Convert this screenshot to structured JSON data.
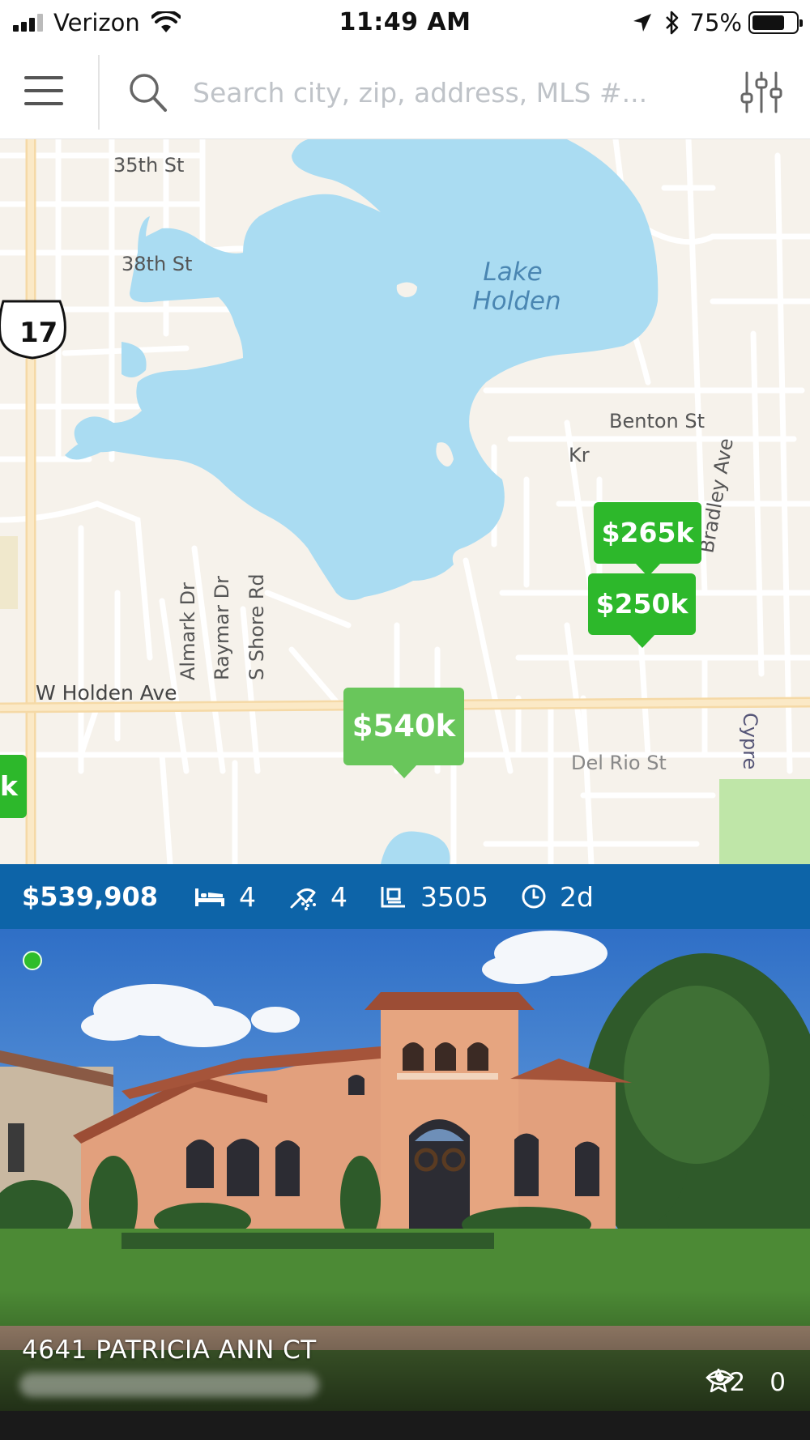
{
  "status_bar": {
    "carrier": "Verizon",
    "time": "11:49 AM",
    "battery_percent": "75%",
    "battery_level": 0.75
  },
  "search": {
    "placeholder": "Search city, zip, address, MLS #..."
  },
  "map": {
    "labels": {
      "lake": "Lake\nHolden",
      "st35": "35th St",
      "st38": "38th St",
      "highway": "17",
      "benton": "Benton St",
      "kr": "Kr",
      "bradley": "Bradley Ave",
      "almark": "Almark Dr",
      "raymar": "Raymar Dr",
      "sshore": "S Shore Rd",
      "holden": "W Holden Ave",
      "delrio": "Del Rio St",
      "cypress": "Cypre"
    },
    "pins": {
      "p265": "$265k",
      "p250": "$250k",
      "p540": "$540k",
      "edge": "k"
    }
  },
  "listing": {
    "price": "$539,908",
    "beds": "4",
    "baths": "4",
    "sqft": "3505",
    "days": "2d",
    "address": "4641 PATRICIA ANN CT",
    "views": "2",
    "favorites": "0"
  },
  "colors": {
    "info_bar": "#0d64a8",
    "pin_green": "#2db82b",
    "pin_selected": "#69c65b",
    "water": "#aadcf2"
  }
}
